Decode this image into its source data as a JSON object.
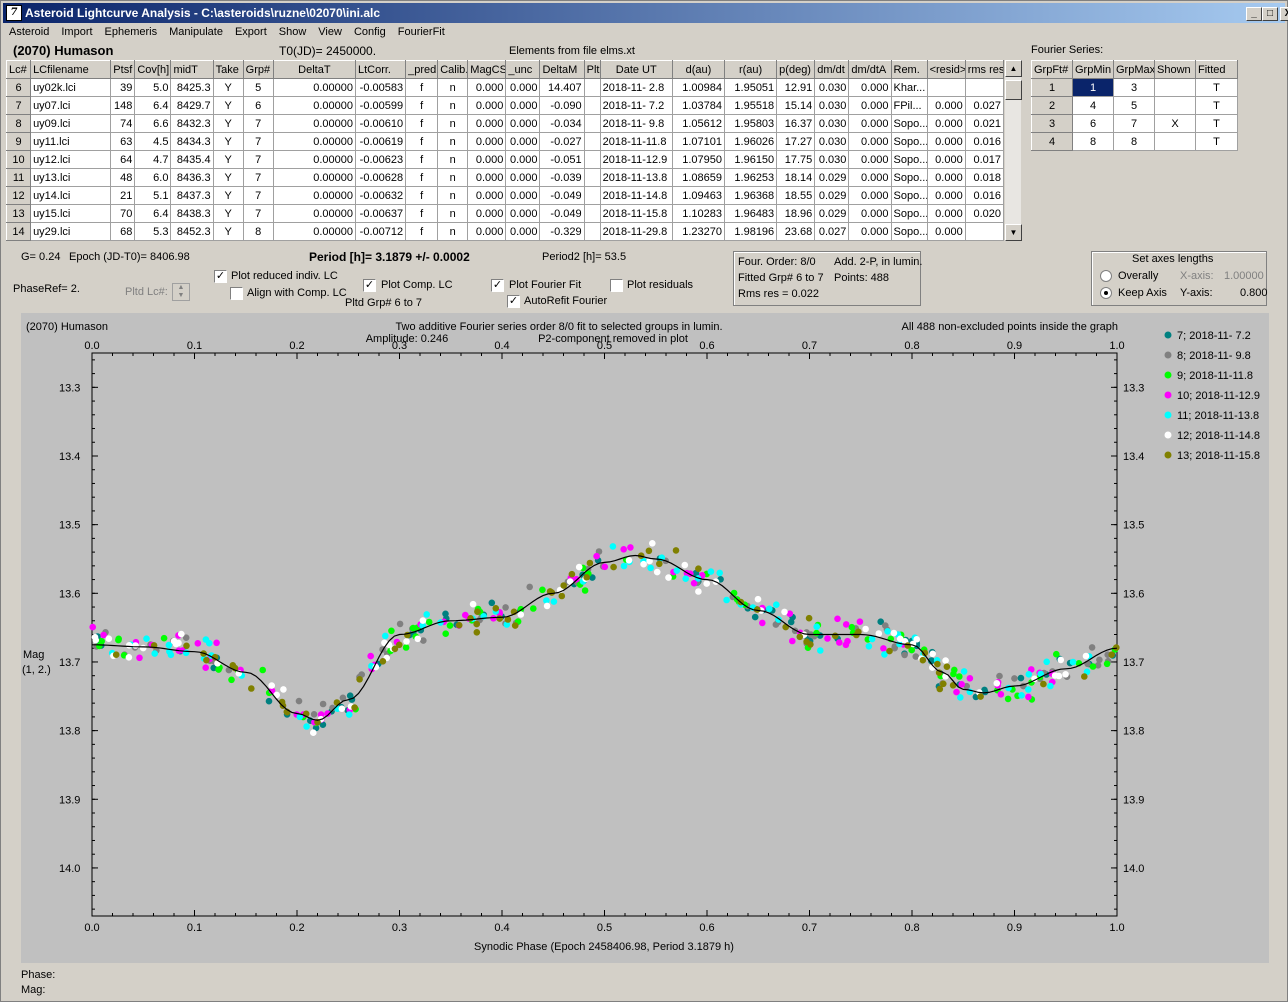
{
  "window": {
    "title": "Asteroid Lightcurve Analysis - C:\\asteroids\\ruzne\\02070\\ini.alc",
    "min": "_",
    "max": "□",
    "close": "X"
  },
  "menu": [
    "Asteroid",
    "Import",
    "Ephemeris",
    "Manipulate",
    "Export",
    "Show",
    "View",
    "Config",
    "FourierFit"
  ],
  "header": {
    "asteroid": "(2070) Humason",
    "t0": "T0(JD)= 2450000.",
    "elements": "Elements from file elms.xt"
  },
  "lc_table": {
    "columns": [
      "Lc#",
      "LCfilename",
      "Ptsf",
      "Cov[h]",
      "midT",
      "Take",
      "Grp#",
      "DeltaT",
      "LtCorr.",
      "_pred.",
      "Calib.",
      "MagCS",
      "_unc",
      "DeltaM",
      "Plt",
      "Date UT",
      "d(au)",
      "r(au)",
      "p(deg)",
      "dm/dt",
      "dm/dtA",
      "Rem.",
      "<resid>",
      "rms res"
    ],
    "rows": [
      [
        "6",
        "uy02k.lci",
        "39",
        "5.0",
        "8425.3",
        "Y",
        "5",
        "0.00000",
        "-0.00583",
        "f",
        "n",
        "0.000",
        "0.000",
        "14.407",
        "",
        "2018-11- 2.8",
        "1.00984",
        "1.95051",
        "12.91",
        "0.030",
        "0.000",
        "Khar...",
        "",
        ""
      ],
      [
        "7",
        "uy07.lci",
        "148",
        "6.4",
        "8429.7",
        "Y",
        "6",
        "0.00000",
        "-0.00599",
        "f",
        "n",
        "0.000",
        "0.000",
        "-0.090",
        "",
        "2018-11- 7.2",
        "1.03784",
        "1.95518",
        "15.14",
        "0.030",
        "0.000",
        "FPil...",
        "0.000",
        "0.027"
      ],
      [
        "8",
        "uy09.lci",
        "74",
        "6.6",
        "8432.3",
        "Y",
        "7",
        "0.00000",
        "-0.00610",
        "f",
        "n",
        "0.000",
        "0.000",
        "-0.034",
        "",
        "2018-11- 9.8",
        "1.05612",
        "1.95803",
        "16.37",
        "0.030",
        "0.000",
        "Sopo...",
        "0.000",
        "0.021"
      ],
      [
        "9",
        "uy11.lci",
        "63",
        "4.5",
        "8434.3",
        "Y",
        "7",
        "0.00000",
        "-0.00619",
        "f",
        "n",
        "0.000",
        "0.000",
        "-0.027",
        "",
        "2018-11-11.8",
        "1.07101",
        "1.96026",
        "17.27",
        "0.030",
        "0.000",
        "Sopo...",
        "0.000",
        "0.016"
      ],
      [
        "10",
        "uy12.lci",
        "64",
        "4.7",
        "8435.4",
        "Y",
        "7",
        "0.00000",
        "-0.00623",
        "f",
        "n",
        "0.000",
        "0.000",
        "-0.051",
        "",
        "2018-11-12.9",
        "1.07950",
        "1.96150",
        "17.75",
        "0.030",
        "0.000",
        "Sopo...",
        "0.000",
        "0.017"
      ],
      [
        "11",
        "uy13.lci",
        "48",
        "6.0",
        "8436.3",
        "Y",
        "7",
        "0.00000",
        "-0.00628",
        "f",
        "n",
        "0.000",
        "0.000",
        "-0.039",
        "",
        "2018-11-13.8",
        "1.08659",
        "1.96253",
        "18.14",
        "0.029",
        "0.000",
        "Sopo...",
        "0.000",
        "0.018"
      ],
      [
        "12",
        "uy14.lci",
        "21",
        "5.1",
        "8437.3",
        "Y",
        "7",
        "0.00000",
        "-0.00632",
        "f",
        "n",
        "0.000",
        "0.000",
        "-0.049",
        "",
        "2018-11-14.8",
        "1.09463",
        "1.96368",
        "18.55",
        "0.029",
        "0.000",
        "Sopo...",
        "0.000",
        "0.016"
      ],
      [
        "13",
        "uy15.lci",
        "70",
        "6.4",
        "8438.3",
        "Y",
        "7",
        "0.00000",
        "-0.00637",
        "f",
        "n",
        "0.000",
        "0.000",
        "-0.049",
        "",
        "2018-11-15.8",
        "1.10283",
        "1.96483",
        "18.96",
        "0.029",
        "0.000",
        "Sopo...",
        "0.000",
        "0.020"
      ],
      [
        "14",
        "uy29.lci",
        "68",
        "5.3",
        "8452.3",
        "Y",
        "8",
        "0.00000",
        "-0.00712",
        "f",
        "n",
        "0.000",
        "0.000",
        "-0.329",
        "",
        "2018-11-29.8",
        "1.23270",
        "1.98196",
        "23.68",
        "0.027",
        "0.000",
        "Sopo...",
        "0.000",
        ""
      ]
    ]
  },
  "fourier_table": {
    "caption": "Fourier Series:",
    "columns": [
      "GrpFt#",
      "GrpMin",
      "GrpMax",
      "Shown",
      "Fitted"
    ],
    "rows": [
      [
        "1",
        "1",
        "3",
        "",
        "T"
      ],
      [
        "2",
        "4",
        "5",
        "",
        "T"
      ],
      [
        "3",
        "6",
        "7",
        "X",
        "T"
      ],
      [
        "4",
        "8",
        "8",
        "",
        "T"
      ]
    ]
  },
  "controls": {
    "g": "G= 0.24",
    "epoch": "Epoch (JD-T0)= 8406.98",
    "period": "Period [h]= 3.1879 +/- 0.0002",
    "period2": "Period2 [h]= 53.5",
    "phaseref": "PhaseRef= 2.",
    "pltd_lc": "Pltd Lc#:",
    "plot_reduced": "Plot reduced indiv. LC",
    "align": "Align with Comp. LC",
    "plot_comp": "Plot Comp. LC",
    "pltd_grp": "Pltd Grp#  6   to   7",
    "plot_fourier": "Plot Fourier Fit",
    "autorefit": "AutoRefit Fourier",
    "plot_residuals": "Plot residuals",
    "check_mark": "✓"
  },
  "fourier_info": {
    "order": "Four. Order:  8/0",
    "add": "Add. 2-P, in lumin.",
    "fitted": "Fitted Grp# 6 to 7",
    "points": "Points: 488",
    "rms": "Rms res      = 0.022"
  },
  "axes_box": {
    "title": "Set axes lengths",
    "overally": "Overally",
    "keep": "Keep Axis",
    "xaxis_label": "X-axis:",
    "xaxis_val": "1.00000",
    "yaxis_label": "Y-axis:",
    "yaxis_val": "0.800"
  },
  "chart_data": {
    "type": "scatter",
    "corner_label": "(2070) Humason",
    "title": "Two additive Fourier series order 8/0 fit to selected groups in lumin.",
    "subtitle_left": "Amplitude: 0.246",
    "subtitle_right": "P2-component removed in plot",
    "note": "All 488 non-excluded points inside the graph",
    "xlabel": "Synodic Phase (Epoch 2458406.98, Period 3.1879 h)",
    "ylabel": "Mag",
    "ylabel2": "(1, 2.)",
    "xlim": [
      0,
      1
    ],
    "ylim": [
      13.25,
      14.07
    ],
    "y_inverted": true,
    "xticks": [
      "0.0",
      "0.1",
      "0.2",
      "0.3",
      "0.4",
      "0.5",
      "0.6",
      "0.7",
      "0.8",
      "0.9",
      "1.0"
    ],
    "yticks": [
      "13.3",
      "13.4",
      "13.5",
      "13.6",
      "13.7",
      "13.8",
      "13.9",
      "14.0"
    ],
    "legend_position": "right",
    "series": [
      {
        "name": "7; 2018-11- 7.2",
        "color": "#008080"
      },
      {
        "name": "8; 2018-11- 9.8",
        "color": "#808080"
      },
      {
        "name": "9; 2018-11-11.8",
        "color": "#00ff00"
      },
      {
        "name": "10; 2018-11-12.9",
        "color": "#ff00ff"
      },
      {
        "name": "11; 2018-11-13.8",
        "color": "#00ffff"
      },
      {
        "name": "12; 2018-11-14.8",
        "color": "#ffffff"
      },
      {
        "name": "13; 2018-11-15.8",
        "color": "#808000"
      }
    ],
    "fit_curve": {
      "x": [
        0.0,
        0.05,
        0.1,
        0.15,
        0.2,
        0.22,
        0.25,
        0.3,
        0.35,
        0.4,
        0.45,
        0.5,
        0.53,
        0.55,
        0.6,
        0.65,
        0.7,
        0.75,
        0.8,
        0.83,
        0.85,
        0.87,
        0.9,
        0.95,
        1.0
      ],
      "y": [
        13.675,
        13.678,
        13.685,
        13.715,
        13.775,
        13.785,
        13.755,
        13.66,
        13.64,
        13.635,
        13.6,
        13.555,
        13.545,
        13.55,
        13.58,
        13.625,
        13.66,
        13.66,
        13.675,
        13.715,
        13.74,
        13.745,
        13.735,
        13.71,
        13.68
      ]
    }
  },
  "status": {
    "phase": "Phase:",
    "mag": "Mag:"
  }
}
